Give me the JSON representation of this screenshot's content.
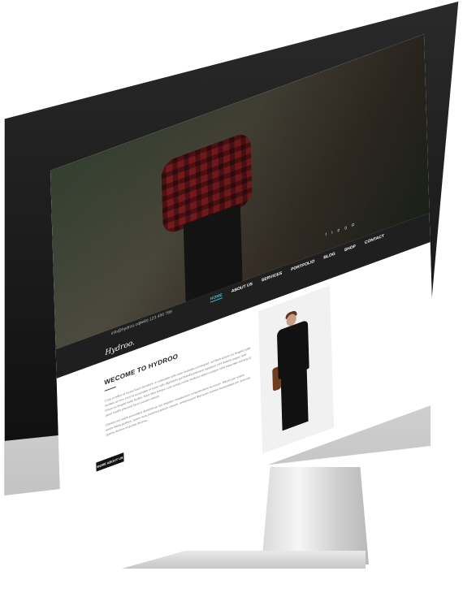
{
  "header": {
    "email": "info@hydroo.com",
    "phone": "(+49) 123 456 789",
    "social_icons": [
      "facebook-icon",
      "twitter-icon",
      "pinterest-icon",
      "google-plus-icon",
      "instagram-icon"
    ]
  },
  "logo": {
    "text": "Hydroo."
  },
  "nav": {
    "items": [
      "HOME",
      "ABOUT US",
      "SERVICES",
      "PORTFOLIO",
      "BLOG",
      "SHOP",
      "CONTACT"
    ],
    "active": "HOME",
    "active_color": "#29c7d6"
  },
  "main": {
    "title": "WECOME TO HYDROO",
    "paragraph_1": "Cras ut tellus at lectus fusce tincidunt. In vulputate velit esse molestie consequat, vel illum dolore eu feugiat nulla facilisis at vero eros et accumsan et iusto odio dignissim qui blandit praesent luptatum zzril delenit augue duis dolore te feugait nulla facilisi. Nam liber tempor cum soluta nobis eleifend option congue nihil imperdiet doming id quod mazim placerat facer possim assum.",
    "paragraph_2": "Claritas est etiam processus dynamicus, qui sequitur mutationem consuetudium lectorum. Mirum est notare quam littera gothica, quam nunc putamus parum claram, anteposuerit litterarum formas humanitatis per seacula quarta decima et quinta decima.",
    "button_label": "MORE ABOUT US"
  },
  "colors": {
    "topbar": "#1f1f1f",
    "button": "#111111"
  }
}
